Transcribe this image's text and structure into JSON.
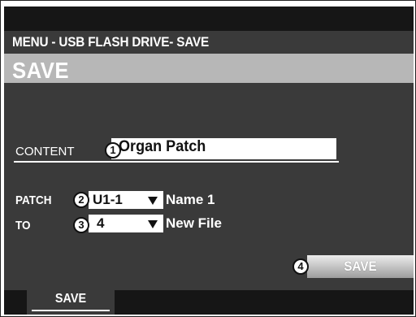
{
  "header": {
    "menu_path": "MENU - USB FLASH DRIVE- SAVE",
    "title": "SAVE"
  },
  "content": {
    "label": "CONTENT",
    "value": "Organ Patch",
    "badge": "1"
  },
  "patch": {
    "label": "PATCH",
    "value": "U1-1",
    "desc": "Name 1",
    "badge": "2"
  },
  "to": {
    "label": "TO",
    "value": "4",
    "desc": "New File",
    "badge": "3"
  },
  "save_button": {
    "label": "SAVE",
    "badge": "4"
  },
  "bottom_tab": {
    "label": "SAVE"
  },
  "icons": [
    "dropdown-arrow-icon",
    "dropdown-arrow-icon"
  ]
}
